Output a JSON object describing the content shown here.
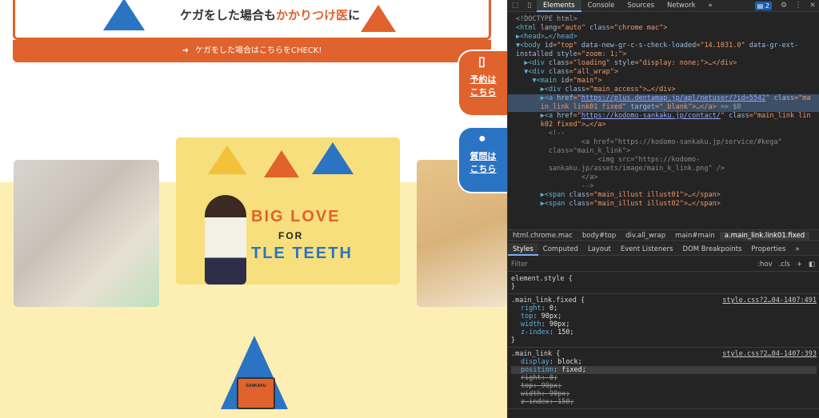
{
  "site": {
    "banner_text_prefix": "ケガをした場合も",
    "banner_text_highlight": "かかりつけ医",
    "banner_text_suffix": "に",
    "banner_cta_arrow": "➜",
    "banner_cta": "ケガをした場合はこちらをCHECK!",
    "reserve_label_1": "予約は",
    "reserve_label_2": "こちら",
    "question_label_1": "質問は",
    "question_label_2": "こちら",
    "poster_line1": "BIG LOVE",
    "poster_line2": "FOR",
    "poster_line3": "TLE TEETH",
    "book_label": "SANKAKU"
  },
  "devtools": {
    "tabs": [
      "Elements",
      "Console",
      "Sources",
      "Network"
    ],
    "more": "»",
    "issues_badge": "2",
    "dom_lines": {
      "l1": "<!DOCTYPE html>",
      "l2a": "<html ",
      "l2b": "lang",
      "l2c": "=\"auto\" ",
      "l2d": "class",
      "l2e": "=\"chrome mac\">",
      "l3": "▶<head>…</head>",
      "l4a": "▼<body ",
      "l4b": "id",
      "l4c": "=\"top\" ",
      "l4d": "data-new-gr-c-s-check-loaded",
      "l4e": "=\"14.1031.0\" ",
      "l4f": "data-gr-ext-",
      "l5a": "installed ",
      "l5b": "style",
      "l5c": "=\"zoom: 1;\">",
      "l6a": "  ▶<div ",
      "l6b": "class",
      "l6c": "=\"loading\" ",
      "l6d": "style",
      "l6e": "=\"display: none;\">…</div>",
      "l7a": "  ▼<div ",
      "l7b": "class",
      "l7c": "=\"all_wrap\">",
      "l8a": "    ▼<main ",
      "l8b": "id",
      "l8c": "=\"main\">",
      "l9a": "      ▶<div ",
      "l9b": "class",
      "l9c": "=\"main_access\">…</div>",
      "l10a": "      ▶<a ",
      "l10b": "href",
      "l10c": "=\"",
      "l10d": "https://plus.dentamap.jp/apl/netuser/?id=5542",
      "l10e": "\" ",
      "l10f": "class",
      "l10g": "=\"ma",
      "l11a": "      in_link link01 fixed\" ",
      "l11b": "target",
      "l11c": "=\"_blank\">…</a>",
      "l11d": " == $0",
      "l12a": "      ▶<a ",
      "l12b": "href",
      "l12c": "=\"",
      "l12d": "https://kodomo-sankaku.jp/contact/",
      "l12e": "\" ",
      "l12f": "class",
      "l12g": "=\"main_link lin",
      "l13": "      k02 fixed\">…</a>",
      "l14": "        <!--",
      "l15": "                <a href=\"https://kodomo-sankaku.jp/service/#kega\"",
      "l16": "        class=\"main_k_link\">",
      "l17": "                    <img src=\"https://kodomo-",
      "l18": "        sankaku.jp/assets/image/main_k_link.png\" />",
      "l19": "                </a>",
      "l20": "                -->",
      "l21a": "      ▶<span ",
      "l21b": "class",
      "l21c": "=\"main_illust illust01\">…</span>",
      "l22a": "      ▶<span ",
      "l22b": "class",
      "l22c": "=\"main_illust illust02\">…</span>"
    },
    "breadcrumbs": [
      "html.chrome.mac",
      "body#top",
      "div.all_wrap",
      "main#main",
      "a.main_link.link01.fixed"
    ],
    "sub_tabs": [
      "Styles",
      "Computed",
      "Layout",
      "Event Listeners",
      "DOM Breakpoints",
      "Properties"
    ],
    "filter_placeholder": "Filter",
    "hov": ":hov",
    "cls": ".cls",
    "plus": "+",
    "rules": {
      "r0_selector": "element.style {",
      "close": "}",
      "r1_selector": ".main_link.fixed {",
      "r1_src": "style.css?2…04-1407:491",
      "r1_p1n": "right",
      "r1_p1v": "0;",
      "r1_p2n": "top",
      "r1_p2v": "90px;",
      "r1_p3n": "width",
      "r1_p3v": "90px;",
      "r1_p4n": "z-index",
      "r1_p4v": "150;",
      "r2_selector": ".main_link {",
      "r2_src": "style.css?2…04-1407:393",
      "r2_p1n": "display",
      "r2_p1v": "block;",
      "r2_p2n": "position",
      "r2_p2v": "fixed;",
      "r2_p3n": "right",
      "r2_p3v": "0;",
      "r2_p4n": "top",
      "r2_p4v": "90px;",
      "r2_p5n": "width",
      "r2_p5v": "90px;",
      "r2_p6n": "z-index",
      "r2_p6v": "150;"
    }
  }
}
